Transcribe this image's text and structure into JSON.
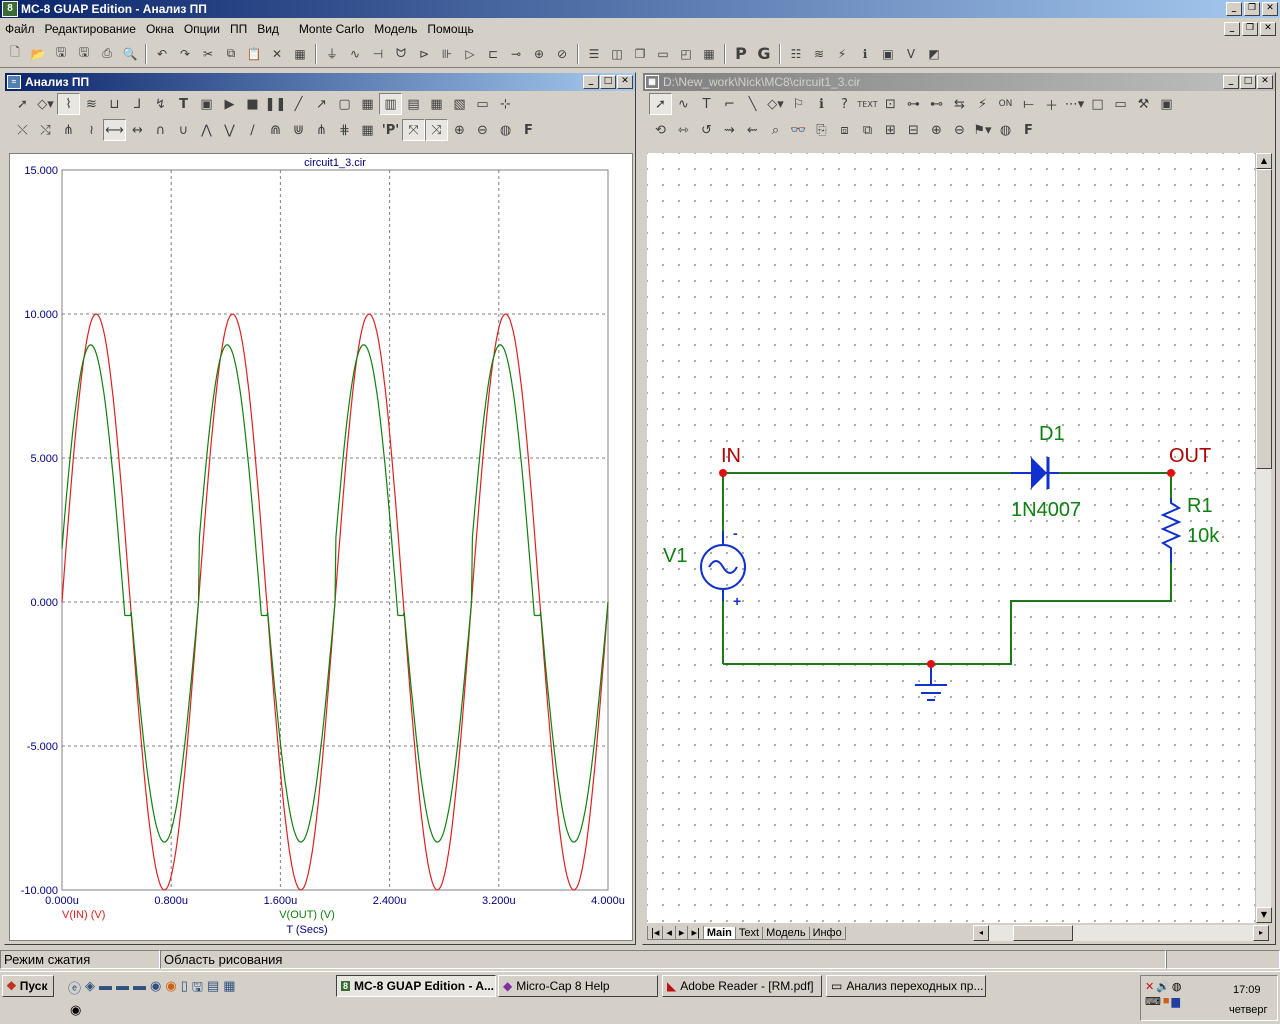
{
  "app": {
    "title": "MC-8 GUAP Edition - Анализ ПП",
    "icon_label": "8"
  },
  "menu": [
    "Файл",
    "Редактирование",
    "Окна",
    "Опции",
    "ПП",
    "Вид",
    "Monte Carlo",
    "Модель",
    "Помощь"
  ],
  "analysis_window": {
    "title": "Анализ ПП"
  },
  "schematic_window": {
    "title": "D:\\New_work\\Nick\\MC8\\circuit1_3.cir"
  },
  "chart_data": {
    "type": "line",
    "title": "circuit1_3.cir",
    "xlabel": "T (Secs)",
    "x_ticks": [
      "0.000u",
      "0.800u",
      "1.600u",
      "2.400u",
      "3.200u",
      "4.000u"
    ],
    "y_ticks": [
      "15.000",
      "10.000",
      "5.000",
      "0.000",
      "-5.000",
      "-10.000"
    ],
    "xlim": [
      0,
      4
    ],
    "ylim": [
      -10,
      15
    ],
    "x_unit": "us",
    "grid": true,
    "series": [
      {
        "name": "V(IN) (V)",
        "color": "#e02020",
        "kind": "sine",
        "amplitude": 10,
        "frequency_mhz": 1
      },
      {
        "name": "V(OUT) (V)",
        "color": "#108010",
        "kind": "rectified",
        "amplitude": 9.4,
        "min": -6.3,
        "frequency_mhz": 1
      }
    ]
  },
  "schematic": {
    "node_in": "IN",
    "node_out": "OUT",
    "diode_name": "D1",
    "diode_model": "1N4007",
    "resistor_name": "R1",
    "resistor_value": "10k",
    "source_name": "V1",
    "source_minus": "-",
    "source_plus": "+",
    "tabs": [
      "Main",
      "Text",
      "Модель",
      "Инфо"
    ]
  },
  "status": {
    "left": "Режим сжатия",
    "middle": "Область рисования"
  },
  "taskbar": {
    "start": "Пуск",
    "tasks": [
      "MC-8 GUAP Edition - A...",
      "Micro-Cap 8 Help",
      "Adobe Reader - [RM.pdf]",
      "Анализ переходных пр..."
    ],
    "clock": "17:09",
    "day": "четверг"
  },
  "colors": {
    "wire": "#1a7a1a",
    "label": "#b00000",
    "component": "#1030d0",
    "value": "#108010"
  }
}
